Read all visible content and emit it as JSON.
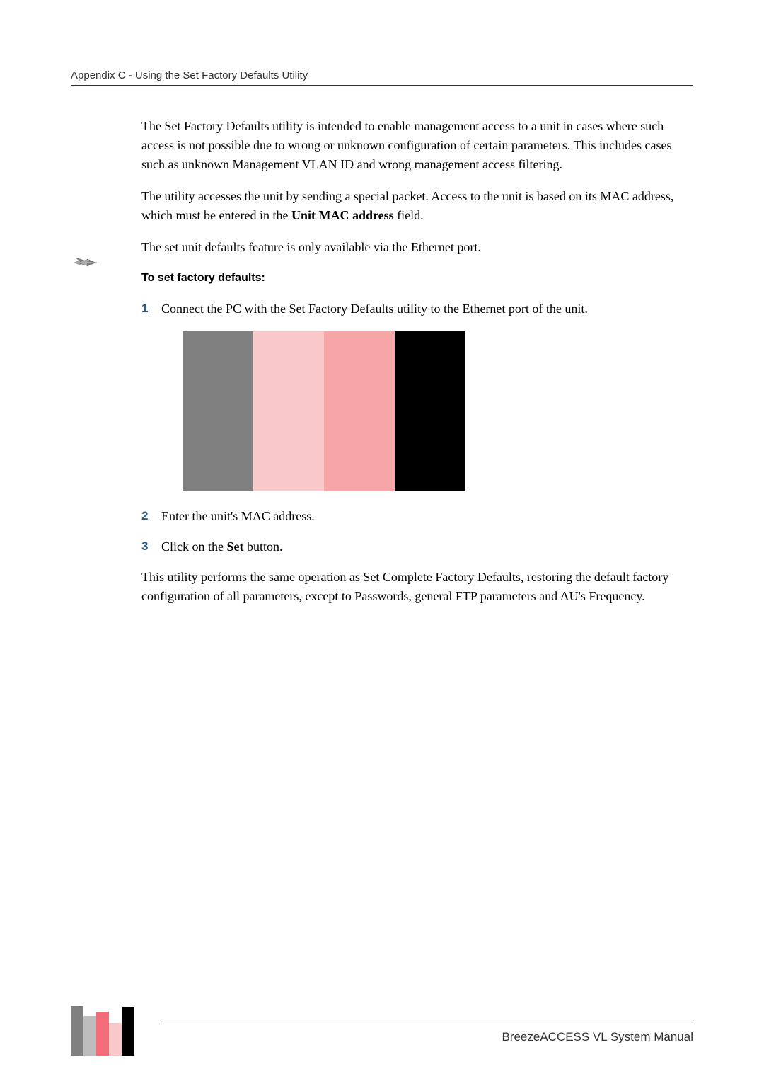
{
  "header": {
    "breadcrumb": "Appendix C - Using the Set Factory Defaults Utility"
  },
  "body": {
    "para1": "The Set Factory Defaults utility is intended to enable management access to a unit in cases where such access is not possible due to wrong or unknown configuration of certain parameters. This includes cases such as unknown Management VLAN ID and wrong management access filtering.",
    "para2_pre": "The utility accesses the unit by sending a special packet. Access to the unit is based on its MAC address, which must be entered in the ",
    "para2_bold": "Unit MAC address",
    "para2_post": " field.",
    "para3": "The set unit defaults feature is only available via the Ethernet port.",
    "subheading": "To set factory defaults:",
    "steps": [
      {
        "num": "1",
        "text": "Connect the PC with the Set Factory Defaults utility to the Ethernet port of the unit."
      },
      {
        "num": "2",
        "text": "Enter the unit's MAC address."
      },
      {
        "num": "3",
        "pre": "Click on the ",
        "bold": "Set",
        "post": " button."
      }
    ],
    "para4": "This utility performs the same operation as Set Complete Factory Defaults, restoring the default factory configuration of all parameters, except to Passwords, general FTP parameters and AU's Frequency."
  },
  "footer": {
    "manual_title": "BreezeACCESS VL System Manual"
  }
}
